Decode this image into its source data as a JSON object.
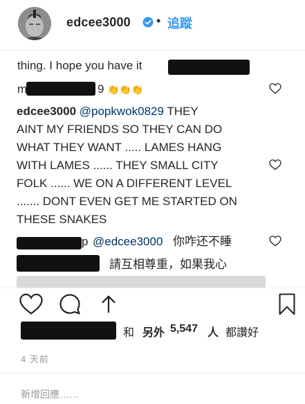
{
  "header": {
    "username": "edcee3000",
    "dot": "•",
    "follow_label": "追蹤"
  },
  "comments": {
    "c1_text": "thing. I hope you have it",
    "c2_suffix": "9",
    "c2_emoji": "👏👏👏",
    "c3": {
      "author": "edcee3000",
      "mention": "@popkwok0829",
      "lines": [
        "THEY",
        "AINT MY FRIENDS SO THEY CAN DO",
        "WHAT THEY WANT ..... LAMES HANG",
        "WITH LAMES ...... THEY SMALL CITY",
        "FOLK ...... WE ON A DIFFERENT LEVEL",
        "....... DONT EVEN GET ME STARTED ON",
        "THESE SNAKES"
      ]
    },
    "c4_suffix": "p",
    "c4_mention": "@edcee3000",
    "c4_text": "你咋还不睡",
    "c5_text": "請互相尊重，如果我心"
  },
  "likes": {
    "and": "和",
    "others": "另外",
    "count": "5,547",
    "unit": "人",
    "liked": "都讚好"
  },
  "time": "4 天前",
  "add_comment_placeholder": "新增回應……",
  "colors": {
    "accent": "#3897f0",
    "text": "#262626",
    "muted": "#999999",
    "redaction": "#111111"
  },
  "icons": [
    "verified-badge-icon",
    "heart-icon",
    "comment-icon",
    "share-icon",
    "bookmark-icon"
  ]
}
